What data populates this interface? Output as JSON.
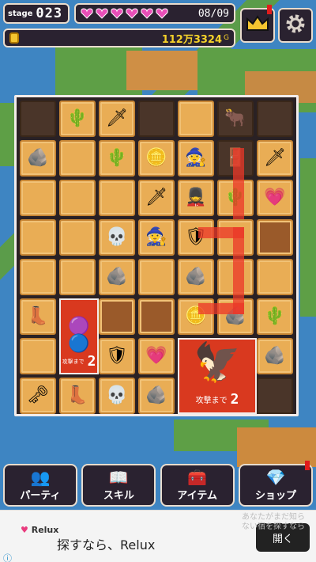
{
  "hud": {
    "stage_label": "stage",
    "stage_number": "023",
    "hp_current_text": "08/09",
    "hearts_full": 6,
    "gold_text": "112万3324",
    "gold_unit": "G"
  },
  "board": {
    "enemy_big_countdown_label": "攻撃まで",
    "enemy_big_countdown": "2",
    "enemy_small_countdown_label": "攻撃まで",
    "enemy_small_countdown": "2"
  },
  "menu": {
    "party_label": "パーティ",
    "skill_label": "スキル",
    "item_label": "アイテム",
    "shop_label": "ショップ"
  },
  "ad": {
    "brand": "Relux",
    "text": "探すなら、Relux",
    "open_label": "開く",
    "bg_text": "あなたがまだ知らない宿を探すなら"
  },
  "colors": {
    "heart": "#e94fb8",
    "gold": "#f6d22a",
    "path": "#eb3728",
    "enemy_tile": "#d9391f"
  }
}
